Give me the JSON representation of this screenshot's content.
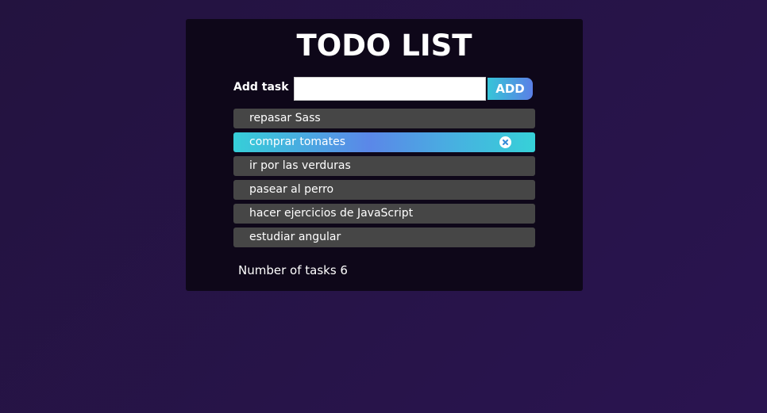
{
  "header": {
    "title": "TODO LIST"
  },
  "form": {
    "label": "Add task",
    "input_value": "",
    "input_placeholder": "",
    "button_label": "ADD"
  },
  "tasks": [
    {
      "text": "repasar Sass",
      "active": false
    },
    {
      "text": "comprar tomates",
      "active": true
    },
    {
      "text": "ir por las verduras",
      "active": false
    },
    {
      "text": "pasear al perro",
      "active": false
    },
    {
      "text": "hacer ejercicios de JavaScript",
      "active": false
    },
    {
      "text": "estudiar angular",
      "active": false
    }
  ],
  "footer": {
    "count_label": "Number of tasks 6"
  },
  "icons": {
    "remove": "close-circle-icon"
  },
  "colors": {
    "background": "#23133f",
    "card": "#0e0719",
    "task_item": "#464646",
    "accent_start": "#36c5d8",
    "accent_end": "#5b7fe6"
  }
}
